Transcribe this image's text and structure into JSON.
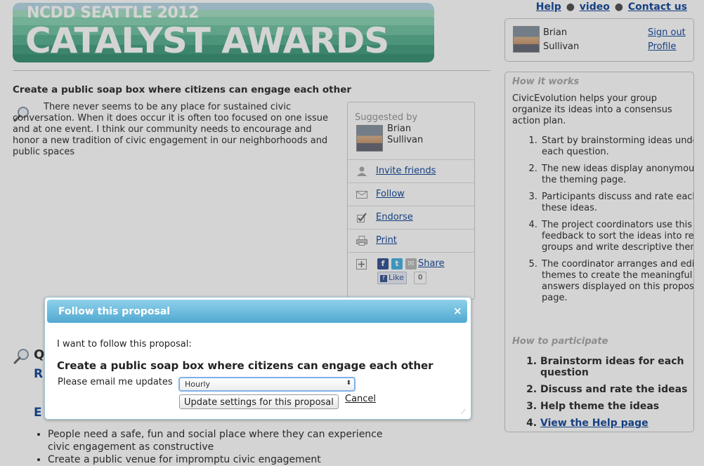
{
  "banner": {
    "subtitle": "NCDD SEATTLE 2012",
    "title": "CATALYST AWARDS"
  },
  "top_links": {
    "help": "Help",
    "video": "video",
    "contact": "Contact us",
    "separator": "●"
  },
  "user": {
    "first": "Brian",
    "last": "Sullivan",
    "sign_out": "Sign out",
    "profile": "Profile"
  },
  "question": {
    "title": "Create a public soap box where citizens can engage each other",
    "text": "There never seems to be any place for sustained civic conversation. When it does occur it is often too focused on one issue and at one event. I think our community needs to encourage and honor a new tradition of civic engagement in our neighborhoods and public spaces"
  },
  "suggested": {
    "label": "Suggested by",
    "first": "Brian",
    "last": "Sullivan",
    "actions": [
      {
        "label": "Invite friends",
        "icon": "person-icon"
      },
      {
        "label": "Follow",
        "icon": "envelope-icon"
      },
      {
        "label": "Endorse",
        "icon": "checkbox-icon"
      },
      {
        "label": "Print",
        "icon": "printer-icon"
      }
    ],
    "share_label": "Share",
    "like_label": "Like",
    "like_count": "0"
  },
  "sidebar": {
    "how_heading": "How it works",
    "intro": "CivicEvolution helps your group organize its ideas into a consensus action plan.",
    "steps": [
      "Start by brainstorming ideas under each question.",
      "The new ideas display anonymously on the theming page.",
      "Participants discuss and rate each of these ideas.",
      "The project coordinators use this feedback to sort the ideas into related groups and write descriptive themes.",
      "The coordinator arranges and edits the themes to create the meaningful answers displayed on this proposal page."
    ],
    "participate_heading": "How to participate",
    "participate": [
      "Brainstorm ideas for each question",
      "Discuss and rate the ideas",
      "Help theme the ideas",
      "View the Help page"
    ]
  },
  "lower": {
    "q_start": "Q",
    "r_start": "R",
    "e_start": "E",
    "bullets": [
      "People need a safe, fun and social place where they can experience civic engagement as constructive",
      "Create a public venue for impromptu civic engagement"
    ]
  },
  "dialog": {
    "title": "Follow this proposal",
    "close": "×",
    "prompt": "I want to follow this proposal:",
    "proposal_name": "Create a public soap box where citizens can engage each other",
    "email_label": "Please email me updates",
    "select_value": "Hourly",
    "select_arrow": "⬍",
    "update_button": "Update settings for this proposal",
    "cancel": "Cancel",
    "grip": "⟋"
  }
}
